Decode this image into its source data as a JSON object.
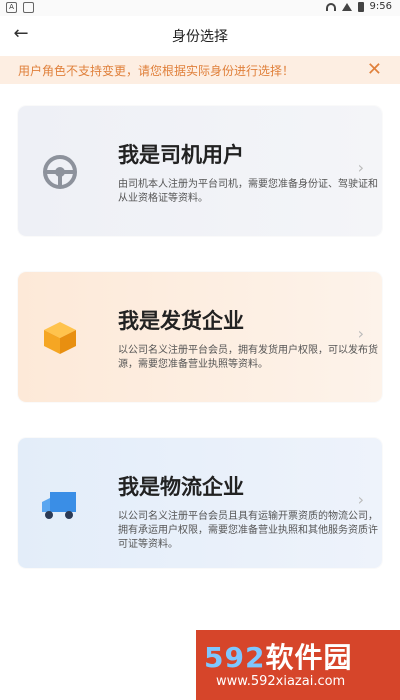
{
  "status_bar": {
    "time": "9:56",
    "left_badge": "A"
  },
  "header": {
    "title": "身份选择"
  },
  "notice": {
    "text": "用户角色不支持变更，请您根据实际身份进行选择！"
  },
  "cards": [
    {
      "title": "我是司机用户",
      "desc": "由司机本人注册为平台司机，需要您准备身份证、驾驶证和从业资格证等资料。",
      "icon": "steering-wheel-icon"
    },
    {
      "title": "我是发货企业",
      "desc": "以公司名义注册平台会员，拥有发货用户权限，可以发布货源，需要您准备营业执照等资料。",
      "icon": "box-icon"
    },
    {
      "title": "我是物流企业",
      "desc": "以公司名义注册平台会员且具有运输开票资质的物流公司，拥有承运用户权限，需要您准备营业执照和其他服务资质许可证等资料。",
      "icon": "truck-icon"
    }
  ],
  "watermark": {
    "brand_num": "592",
    "brand_text": "软件园",
    "url": "www.592xiazai.com"
  }
}
